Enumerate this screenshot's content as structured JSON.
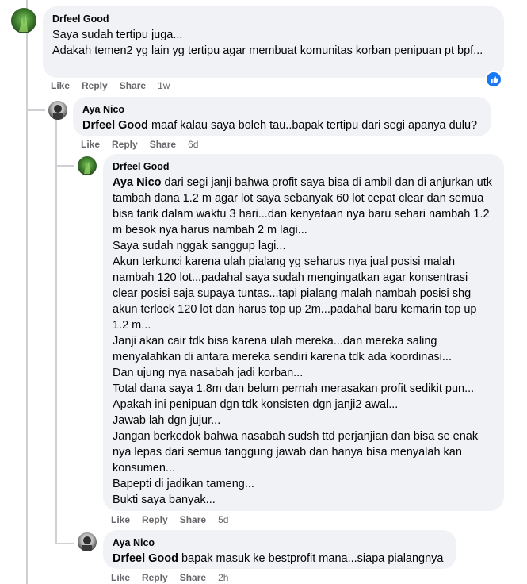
{
  "comments": [
    {
      "author": "Drfeel Good",
      "body": "Saya sudah tertipu juga...\nAdakah temen2 yg lain yg tertipu agar membuat komunitas korban penipuan pt bpf...",
      "actions": {
        "like": "Like",
        "reply": "Reply",
        "share": "Share",
        "time": "1w"
      },
      "reaction": "like"
    },
    {
      "author": "Aya Nico",
      "mention": "Drfeel Good",
      "body": " maaf kalau saya boleh tau..bapak tertipu dari segi apanya dulu?",
      "actions": {
        "like": "Like",
        "reply": "Reply",
        "share": "Share",
        "time": "6d"
      }
    },
    {
      "author": "Drfeel Good",
      "mention": "Aya Nico",
      "body": " dari segi janji bahwa profit saya bisa di ambil dan di anjurkan utk tambah dana 1.2 m agar lot saya sebanyak 60 lot cepat clear dan semua bisa tarik dalam waktu 3 hari...dan kenyataan nya baru sehari nambah 1.2 m besok nya harus nambah 2 m lagi...\nSaya sudah nggak sanggup lagi...\nAkun terkunci karena ulah pialang yg seharus nya jual posisi malah nambah 120 lot...padahal saya sudah mengingatkan agar konsentrasi clear posisi saja supaya tuntas...tapi pialang malah nambah posisi shg akun terlock 120 lot dan harus top up 2m...padahal baru kemarin top up 1.2 m...\nJanji akan cair tdk bisa karena ulah mereka...dan mereka saling menyalahkan di antara mereka sendiri karena tdk ada koordinasi...\nDan ujung nya nasabah jadi korban...\nTotal dana saya 1.8m dan belum pernah merasakan profit sedikit pun...\nApakah ini penipuan dgn tdk konsisten dgn janji2 awal...\nJawab lah dgn jujur...\nJangan berkedok bahwa nasabah sudsh ttd perjanjian dan bisa se enak nya lepas dari semua tanggung jawab dan hanya bisa menyalah kan konsumen...\nBapepti di jadikan tameng...\nBukti saya banyak...",
      "actions": {
        "like": "Like",
        "reply": "Reply",
        "share": "Share",
        "time": "5d"
      }
    },
    {
      "author": "Aya Nico",
      "mention": "Drfeel Good",
      "body": " bapak masuk ke bestprofit mana...siapa pialangnya",
      "actions": {
        "like": "Like",
        "reply": "Reply",
        "share": "Share",
        "time": "2h"
      }
    }
  ],
  "colors": {
    "bubble": "#f0f2f5",
    "meta": "#65676b",
    "accent": "#1877f2"
  }
}
